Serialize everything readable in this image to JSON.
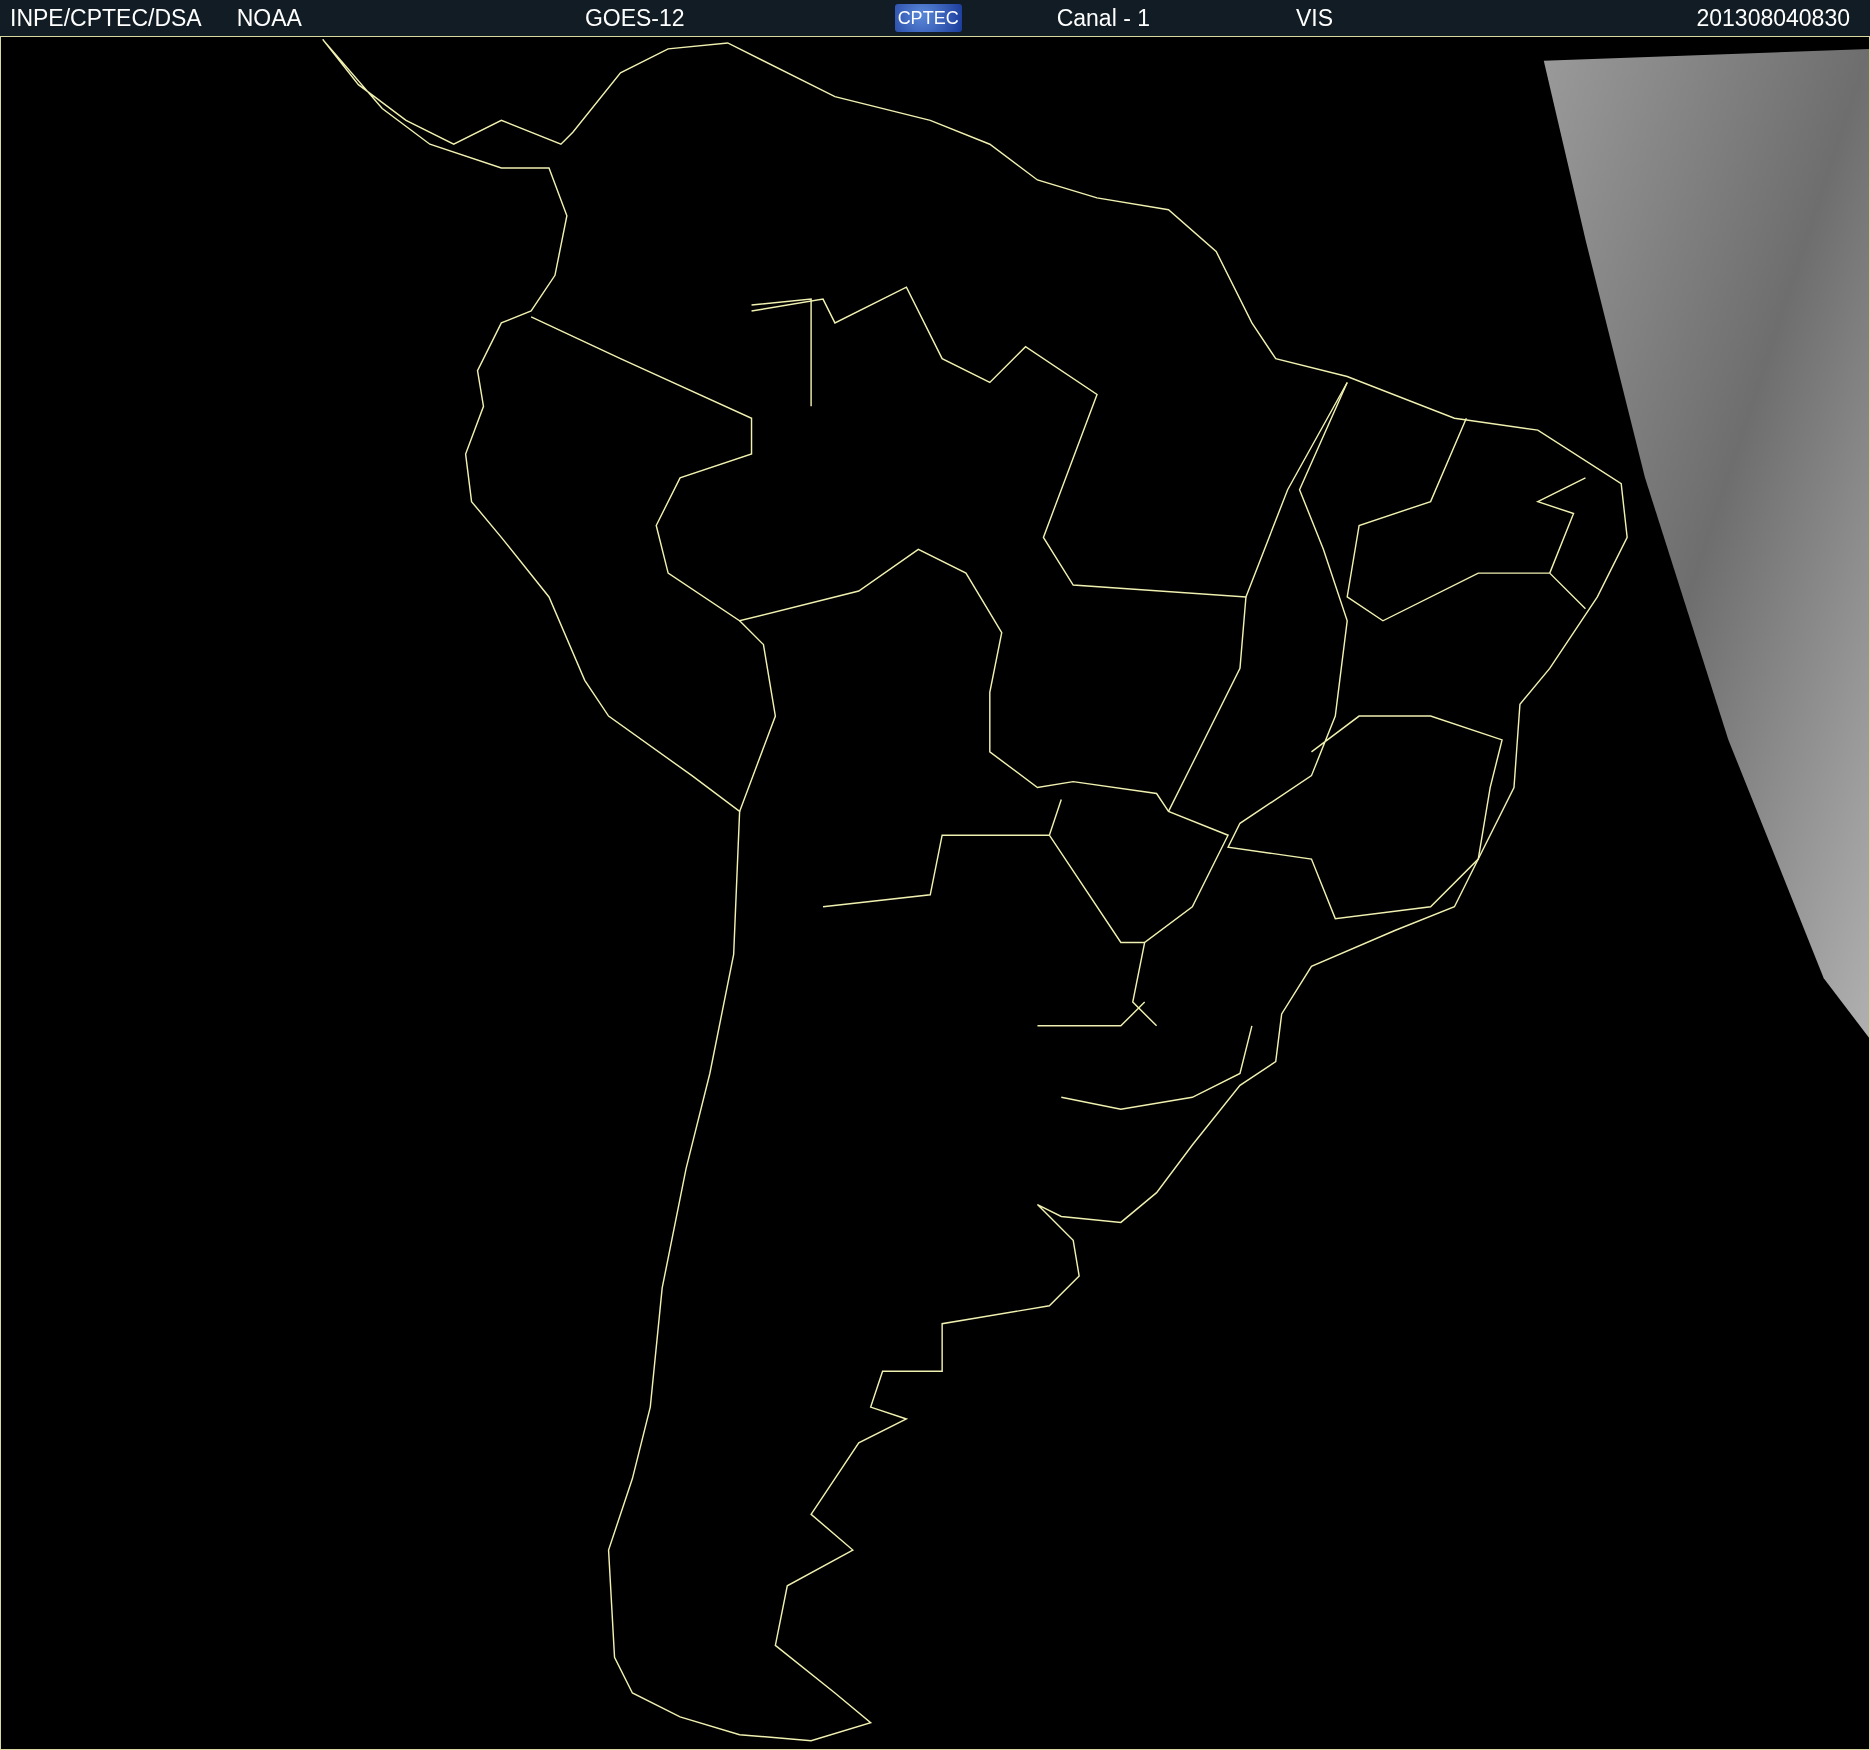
{
  "header": {
    "items": [
      {
        "kind": "text",
        "label": "INPE/CPTEC/DSA"
      },
      {
        "kind": "text",
        "label": "NOAA"
      },
      {
        "kind": "text",
        "label": "GOES-12"
      },
      {
        "kind": "logo",
        "label": "CPTEC"
      },
      {
        "kind": "text",
        "label": "Canal - 1"
      },
      {
        "kind": "text",
        "label": "VIS"
      },
      {
        "kind": "text",
        "label": "201308040830"
      }
    ]
  }
}
